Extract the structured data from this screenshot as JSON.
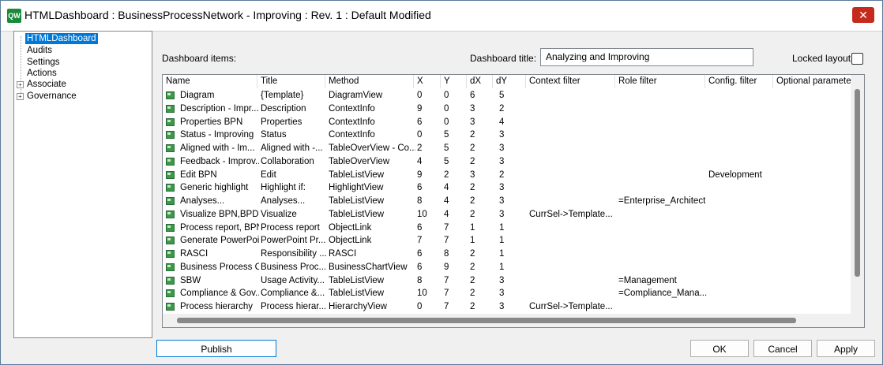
{
  "window": {
    "title": "HTMLDashboard : BusinessProcessNetwork - Improving : Rev. 1 : Default Modified",
    "app_icon": "qw-app-icon",
    "close_icon": "close-icon"
  },
  "tree": {
    "items": [
      {
        "label": "HTMLDashboard",
        "selected": true,
        "expander": ""
      },
      {
        "label": "Audits",
        "expander": ""
      },
      {
        "label": "Settings",
        "expander": ""
      },
      {
        "label": "Actions",
        "expander": ""
      },
      {
        "label": "Associate",
        "expander": "+"
      },
      {
        "label": "Governance",
        "expander": "+"
      }
    ]
  },
  "labels": {
    "dashboard_items": "Dashboard items:",
    "dashboard_title": "Dashboard title:",
    "locked_layout": "Locked layout:"
  },
  "title_input": {
    "value": "Analyzing and Improving"
  },
  "table": {
    "columns": [
      "Name",
      "Title",
      "Method",
      "X",
      "Y",
      "dX",
      "dY",
      "Context filter",
      "Role filter",
      "Config. filter",
      "Optional parameters"
    ],
    "rows": [
      [
        "Diagram",
        "{Template}",
        "DiagramView",
        "0",
        "0",
        "6",
        "5",
        "",
        "",
        "",
        ""
      ],
      [
        "Description - Impr...",
        "Description",
        "ContextInfo",
        "9",
        "0",
        "3",
        "2",
        "",
        "",
        "",
        ""
      ],
      [
        "Properties BPN",
        "Properties",
        "ContextInfo",
        "6",
        "0",
        "3",
        "4",
        "",
        "",
        "",
        ""
      ],
      [
        "Status - Improving",
        "Status",
        "ContextInfo",
        "0",
        "5",
        "2",
        "3",
        "",
        "",
        "",
        ""
      ],
      [
        "Aligned with - Im...",
        "Aligned with -...",
        "TableOverView - Co...",
        "2",
        "5",
        "2",
        "3",
        "",
        "",
        "",
        ""
      ],
      [
        "Feedback - Improv...",
        "Collaboration",
        "TableOverView",
        "4",
        "5",
        "2",
        "3",
        "",
        "",
        "",
        ""
      ],
      [
        "Edit BPN",
        "Edit",
        "TableListView",
        "9",
        "2",
        "3",
        "2",
        "",
        "",
        "Development",
        ""
      ],
      [
        "Generic highlight",
        "Highlight if:",
        "HighlightView",
        "6",
        "4",
        "2",
        "3",
        "",
        "",
        "",
        ""
      ],
      [
        "Analyses...",
        "Analyses...",
        "TableListView",
        "8",
        "4",
        "2",
        "3",
        "",
        "=Enterprise_Architect",
        "",
        ""
      ],
      [
        "Visualize BPN,BPD...",
        "Visualize",
        "TableListView",
        "10",
        "4",
        "2",
        "3",
        "CurrSel->Template...",
        "",
        "",
        ""
      ],
      [
        "Process report, BPN",
        "Process report",
        "ObjectLink",
        "6",
        "7",
        "1",
        "1",
        "",
        "",
        "",
        ""
      ],
      [
        "Generate PowerPoint",
        "PowerPoint Pr...",
        "ObjectLink",
        "7",
        "7",
        "1",
        "1",
        "",
        "",
        "",
        ""
      ],
      [
        "RASCI",
        "Responsibility ...",
        "RASCI",
        "6",
        "8",
        "2",
        "1",
        "",
        "",
        "",
        ""
      ],
      [
        "Business Process C...",
        "Business Proc...",
        "BusinessChartView",
        "6",
        "9",
        "2",
        "1",
        "",
        "",
        "",
        ""
      ],
      [
        "SBW",
        "Usage Activity...",
        "TableListView",
        "8",
        "7",
        "2",
        "3",
        "",
        "=Management",
        "",
        ""
      ],
      [
        "Compliance & Gov...",
        "Compliance &...",
        "TableListView",
        "10",
        "7",
        "2",
        "3",
        "",
        "=Compliance_Mana...",
        "",
        ""
      ],
      [
        "Process hierarchy",
        "Process hierar...",
        "HierarchyView",
        "0",
        "7",
        "2",
        "3",
        "CurrSel->Template...",
        "",
        "",
        ""
      ]
    ]
  },
  "buttons": {
    "publish": "Publish",
    "ok": "OK",
    "cancel": "Cancel",
    "apply": "Apply"
  },
  "colors": {
    "selection": "#0078d7",
    "close": "#c42b1c",
    "row_icon": "#3a9a4a"
  }
}
